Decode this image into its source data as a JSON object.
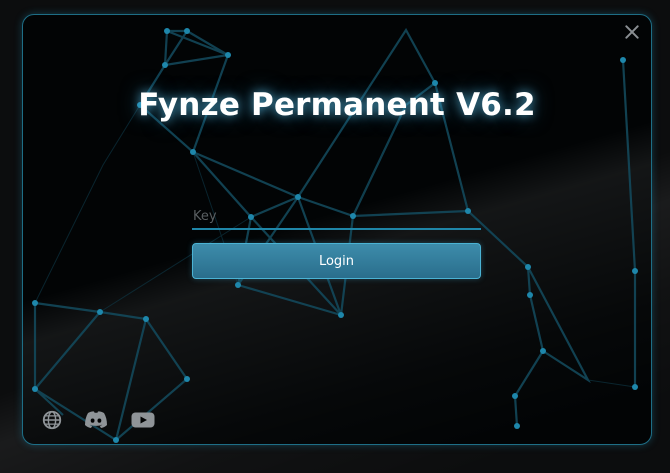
{
  "window": {
    "title": "Fynze Permanent V6.2",
    "close_icon": "close-icon"
  },
  "login": {
    "key_placeholder": "Key",
    "key_value": "",
    "button_label": "Login"
  },
  "footer": {
    "icons": [
      "globe-icon",
      "discord-icon",
      "youtube-icon"
    ]
  },
  "colors": {
    "accent": "#2a8db0",
    "background": "#020405",
    "button": "#3a8aa8",
    "text": "#ffffff"
  }
}
